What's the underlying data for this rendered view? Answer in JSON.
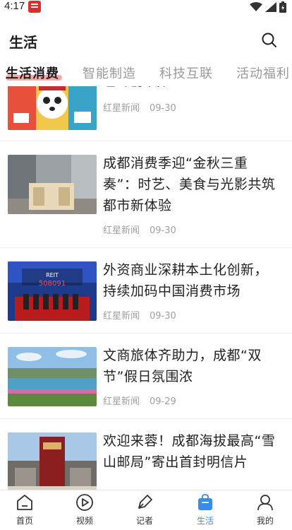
{
  "status": {
    "time": "4:17"
  },
  "header": {
    "title": "生活"
  },
  "tabs": [
    {
      "label": "生活消费"
    },
    {
      "label": "智能制造"
    },
    {
      "label": "科技互联"
    },
    {
      "label": "活动福利"
    }
  ],
  "news": [
    {
      "title": "包”免费领",
      "source": "红星新闻",
      "date": "09-30"
    },
    {
      "title": "成都消费季迎“金秋三重奏”：时艺、美食与光影共筑都市新体验",
      "source": "红星新闻",
      "date": "09-30"
    },
    {
      "title": "外资商业深耕本土化创新，持续加码中国消费市场",
      "source": "红星新闻",
      "date": "09-30"
    },
    {
      "title": "文商旅体齐助力，成都“双节”假日氛围浓",
      "source": "红星新闻",
      "date": "09-29"
    },
    {
      "title": "欢迎来蓉！成都海拔最高“雪山邮局”寄出首封明信片",
      "source": "",
      "date": ""
    }
  ],
  "thumb3": {
    "ticker": "508091",
    "tag": "REIT"
  },
  "nav": [
    {
      "label": "首页"
    },
    {
      "label": "视频"
    },
    {
      "label": "记者"
    },
    {
      "label": "生活"
    },
    {
      "label": "我的"
    }
  ],
  "colors": {
    "accent": "#3a8be8",
    "tab_underline": "#f29a9a",
    "meta": "#a0a0a0"
  }
}
